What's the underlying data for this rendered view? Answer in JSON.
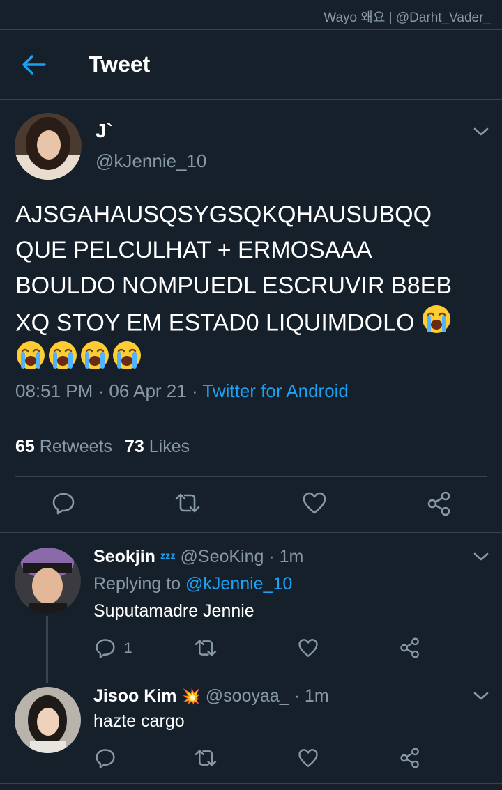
{
  "watermark": "Wayo 왜요 | @Darht_Vader_",
  "header": {
    "title": "Tweet"
  },
  "tweet": {
    "name": "J`",
    "handle": "@kJennie_10",
    "text": "AJSGAHAUSQSYGSQKQHAUSUBQQ\nQUE PELCULHAT + ERMOSAAA\nBOULDO NOMPUEDL ESCRUVIR B8EB\nXQ STOY EM ESTAD0 LIQUIMDOLO",
    "emoji": "😭",
    "emoji_count": 5,
    "time": "08:51 PM",
    "date": "06 Apr 21",
    "separator": " · ",
    "source": "Twitter for Android",
    "retweets_count": "65",
    "retweets_label": "Retweets",
    "likes_count": "73",
    "likes_label": "Likes"
  },
  "replies": [
    {
      "name": "Seokjin",
      "badge": "ᶻᶻᶻ",
      "handle": "@SeoKing · 1m",
      "replying_prefix": "Replying to ",
      "replying_to": "@kJennie_10",
      "text": "Suputamadre Jennie",
      "reply_count": "1"
    },
    {
      "name": "Jisoo Kim",
      "badge": "💥",
      "handle": "@sooyaa_ · 1m",
      "text": "hazte cargo",
      "reply_count": ""
    }
  ],
  "icons": {
    "back": "arrow-left-icon",
    "more": "chevron-down-icon",
    "reply": "comment-icon",
    "retweet": "retweet-icon",
    "like": "heart-icon",
    "share": "share-icon"
  },
  "colors": {
    "background": "#15202b",
    "accent": "#1da1f2",
    "secondary_text": "#8899a6",
    "divider": "#38444d"
  }
}
